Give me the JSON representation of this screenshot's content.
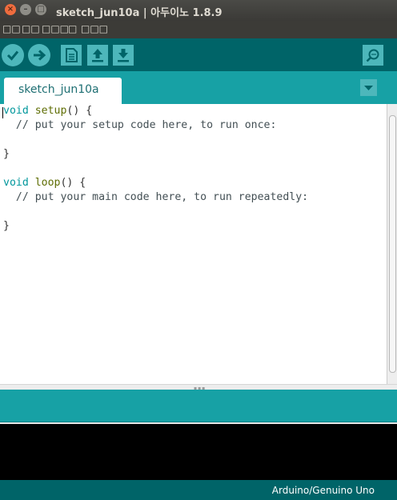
{
  "window": {
    "title": "sketch_jun10a | 아두이노 1.8.9",
    "close_glyph": "×",
    "minimize_glyph": "–",
    "maximize_glyph": "□"
  },
  "menu": {
    "items": [
      "□□",
      "□□",
      "□□□",
      "□",
      "□□□"
    ]
  },
  "toolbar": {
    "buttons": [
      {
        "name": "verify",
        "icon": "check-icon"
      },
      {
        "name": "upload",
        "icon": "arrow-right-icon"
      },
      {
        "name": "new",
        "icon": "new-file-icon"
      },
      {
        "name": "open",
        "icon": "arrow-up-icon"
      },
      {
        "name": "save",
        "icon": "arrow-down-icon"
      },
      {
        "name": "serial-monitor",
        "icon": "magnifier-icon"
      }
    ],
    "colors": {
      "bar": "#006468",
      "button": "#4db7bb"
    }
  },
  "tabs": [
    {
      "label": "sketch_jun10a",
      "active": true
    }
  ],
  "tab_menu_icon": "chevron-down-icon",
  "editor": {
    "setup_kw": "void",
    "setup_fn": "setup",
    "setup_open": "() {",
    "setup_comment": "  // put your setup code here, to run once:",
    "setup_close": "}",
    "loop_kw": "void",
    "loop_fn": "loop",
    "loop_open": "() {",
    "loop_comment": "  // put your main code here, to run repeatedly:",
    "loop_close": "}"
  },
  "statusbar": {
    "board": "Arduino/Genuino Uno"
  }
}
